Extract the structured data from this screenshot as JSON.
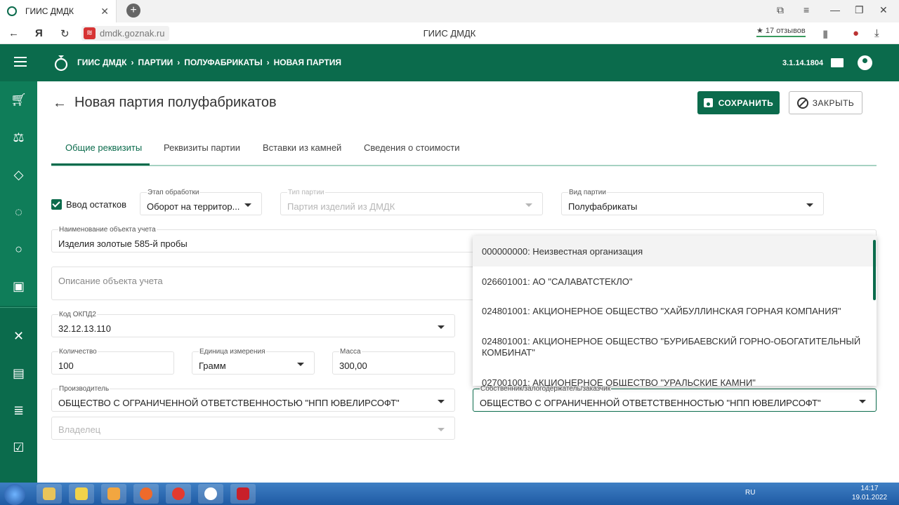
{
  "browser": {
    "tab_title": "ГИИС ДМДК",
    "url": "dmdk.goznak.ru",
    "page_title": "ГИИС ДМДК",
    "reviews": "17 отзывов"
  },
  "appbar": {
    "breadcrumbs": [
      "ГИИС ДМДК",
      "ПАРТИИ",
      "ПОЛУФАБРИКАТЫ",
      "НОВАЯ ПАРТИЯ"
    ],
    "version": "3.1.14.1804"
  },
  "page": {
    "title": "Новая партия полуфабрикатов",
    "save_label": "СОХРАНИТЬ",
    "close_label": "ЗАКРЫТЬ"
  },
  "tabs": [
    {
      "label": "Общие реквизиты",
      "active": true
    },
    {
      "label": "Реквизиты партии",
      "active": false
    },
    {
      "label": "Вставки из камней",
      "active": false
    },
    {
      "label": "Сведения о стоимости",
      "active": false
    }
  ],
  "form": {
    "residue_checkbox": {
      "label": "Ввод остатков",
      "checked": true
    },
    "stage": {
      "label": "Этап обработки",
      "value": "Оборот на территор..."
    },
    "batch_type": {
      "label": "Тип партии",
      "value": "Партия изделий из ДМДК",
      "disabled": true
    },
    "batch_kind": {
      "label": "Вид партии",
      "value": "Полуфабрикаты"
    },
    "object_name": {
      "label": "Наименование объекта учета",
      "value": "Изделия золотые 585-й пробы"
    },
    "object_description": {
      "placeholder": "Описание объекта учета"
    },
    "okpd2": {
      "label": "Код ОКПД2",
      "value": "32.12.13.110"
    },
    "quantity": {
      "label": "Количество",
      "value": "100"
    },
    "unit": {
      "label": "Единица измерения",
      "value": "Грамм"
    },
    "mass": {
      "label": "Масса",
      "value": "300,00"
    },
    "manufacturer": {
      "label": "Производитель",
      "value": "ОБЩЕСТВО С ОГРАНИЧЕННОЙ ОТВЕТСТВЕННОСТЬЮ \"НПП ЮВЕЛИРСОФТ\""
    },
    "owner_placeholder": {
      "placeholder": "Владелец"
    },
    "owner_pledgee": {
      "label": "Собственник/залогодержатель/заказчик",
      "value": "ОБЩЕСТВО С ОГРАНИЧЕННОЙ ОТВЕТСТВЕННОСТЬЮ \"НПП ЮВЕЛИРСОФТ\""
    }
  },
  "dropdown_options": [
    "000000000: Неизвестная организация",
    "026601001: АО \"САЛАВАТСТЕКЛО\"",
    "024801001: АКЦИОНЕРНОЕ ОБЩЕСТВО \"ХАЙБУЛЛИНСКАЯ ГОРНАЯ КОМПАНИЯ\"",
    "024801001: АКЦИОНЕРНОЕ ОБЩЕСТВО \"БУРИБАЕВСКИЙ ГОРНО-ОБОГАТИТЕЛЬНЫЙ КОМБИНАТ\"",
    "027001001: АКЦИОНЕРНОЕ ОБЩЕСТВО \"УРАЛЬСКИЕ КАМНИ\""
  ],
  "taskbar": {
    "language": "RU",
    "time": "14:17",
    "date": "19.01.2022"
  },
  "colors": {
    "brand": "#0b6b4c",
    "accent_underline": "#a6d2c2"
  },
  "icons": [
    "hamburger-icon",
    "logo-icon",
    "mail-icon",
    "user-avatar-icon",
    "cart-icon",
    "scale-icon",
    "diamond-icon",
    "circle-icon",
    "ring-icon",
    "box-icon",
    "tools-icon",
    "contacts-icon",
    "list-icon",
    "checklist-icon"
  ]
}
